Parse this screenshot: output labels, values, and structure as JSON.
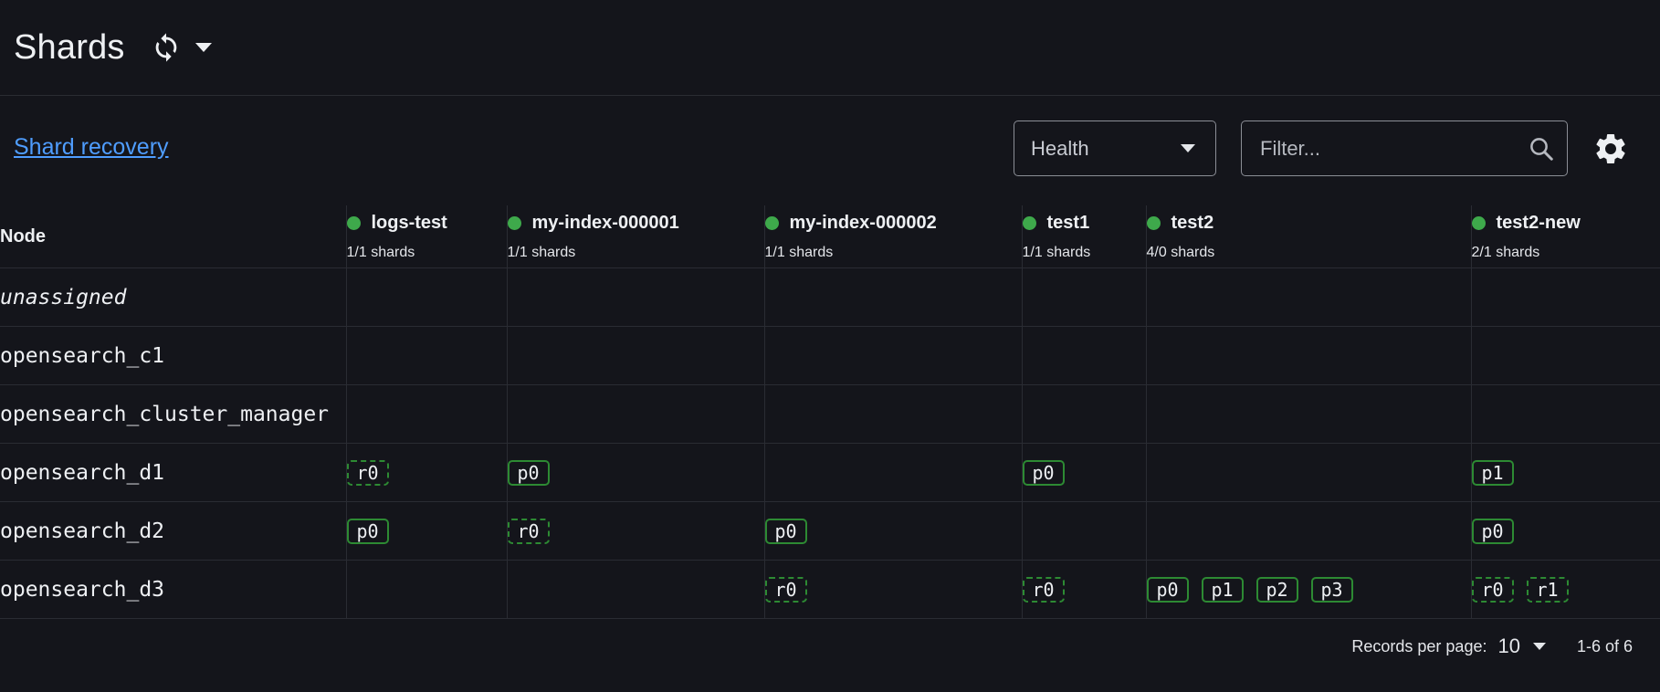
{
  "header": {
    "title": "Shards"
  },
  "toolbar": {
    "recovery_link": "Shard recovery",
    "health_label": "Health",
    "filter_placeholder": "Filter..."
  },
  "table": {
    "node_header": "Node",
    "indices": [
      {
        "name": "logs-test",
        "shards": "1/1 shards",
        "status_color": "#3ea94b"
      },
      {
        "name": "my-index-000001",
        "shards": "1/1 shards",
        "status_color": "#3ea94b"
      },
      {
        "name": "my-index-000002",
        "shards": "1/1 shards",
        "status_color": "#3ea94b"
      },
      {
        "name": "test1",
        "shards": "1/1 shards",
        "status_color": "#3ea94b"
      },
      {
        "name": "test2",
        "shards": "4/0 shards",
        "status_color": "#3ea94b"
      },
      {
        "name": "test2-new",
        "shards": "2/1 shards",
        "status_color": "#3ea94b"
      }
    ],
    "rows": [
      {
        "node": "unassigned",
        "italic": true,
        "cells": [
          [],
          [],
          [],
          [],
          [],
          []
        ]
      },
      {
        "node": "opensearch_c1",
        "cells": [
          [],
          [],
          [],
          [],
          [],
          []
        ]
      },
      {
        "node": "opensearch_cluster_manager",
        "cells": [
          [],
          [],
          [],
          [],
          [],
          []
        ]
      },
      {
        "node": "opensearch_d1",
        "cells": [
          [
            "r0"
          ],
          [
            "p0"
          ],
          [],
          [
            "p0"
          ],
          [],
          [
            "p1"
          ]
        ]
      },
      {
        "node": "opensearch_d2",
        "cells": [
          [
            "p0"
          ],
          [
            "r0"
          ],
          [
            "p0"
          ],
          [],
          [],
          [
            "p0"
          ]
        ]
      },
      {
        "node": "opensearch_d3",
        "cells": [
          [],
          [],
          [
            "r0"
          ],
          [
            "r0"
          ],
          [
            "p0",
            "p1",
            "p2",
            "p3"
          ],
          [
            "r0",
            "r1"
          ]
        ]
      }
    ]
  },
  "pager": {
    "label": "Records per page:",
    "value": "10",
    "range": "1-6 of 6"
  }
}
